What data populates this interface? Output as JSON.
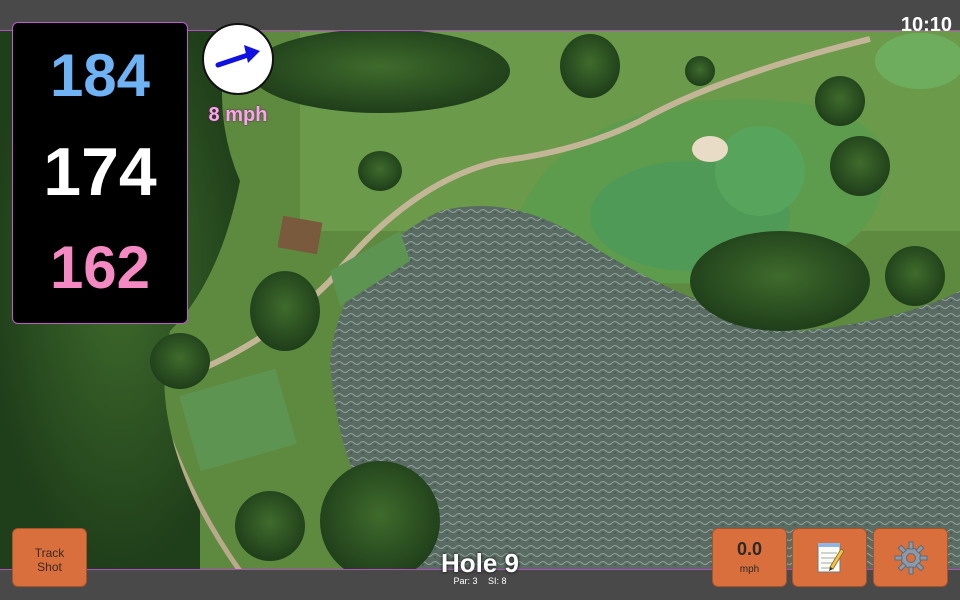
{
  "status_bar": {
    "time": "10:10"
  },
  "distances": {
    "back": "184",
    "middle": "174",
    "front": "162"
  },
  "wind": {
    "speed_label": "8 mph",
    "direction_icon": "arrow-icon"
  },
  "buttons": {
    "track_shot_line1": "Track",
    "track_shot_line2": "Shot",
    "wind_speed_value": "0.0",
    "wind_speed_unit": "mph",
    "notes_icon": "notepad-icon",
    "settings_icon": "gear-icon"
  },
  "hole": {
    "title": "Hole 9",
    "par_label": "Par: 3",
    "si_label": "SI: 8"
  },
  "colors": {
    "back": "#6fb3f5",
    "middle": "#ffffff",
    "front": "#f58ac3",
    "accent": "#d86f3c",
    "border": "#c25bd0"
  }
}
